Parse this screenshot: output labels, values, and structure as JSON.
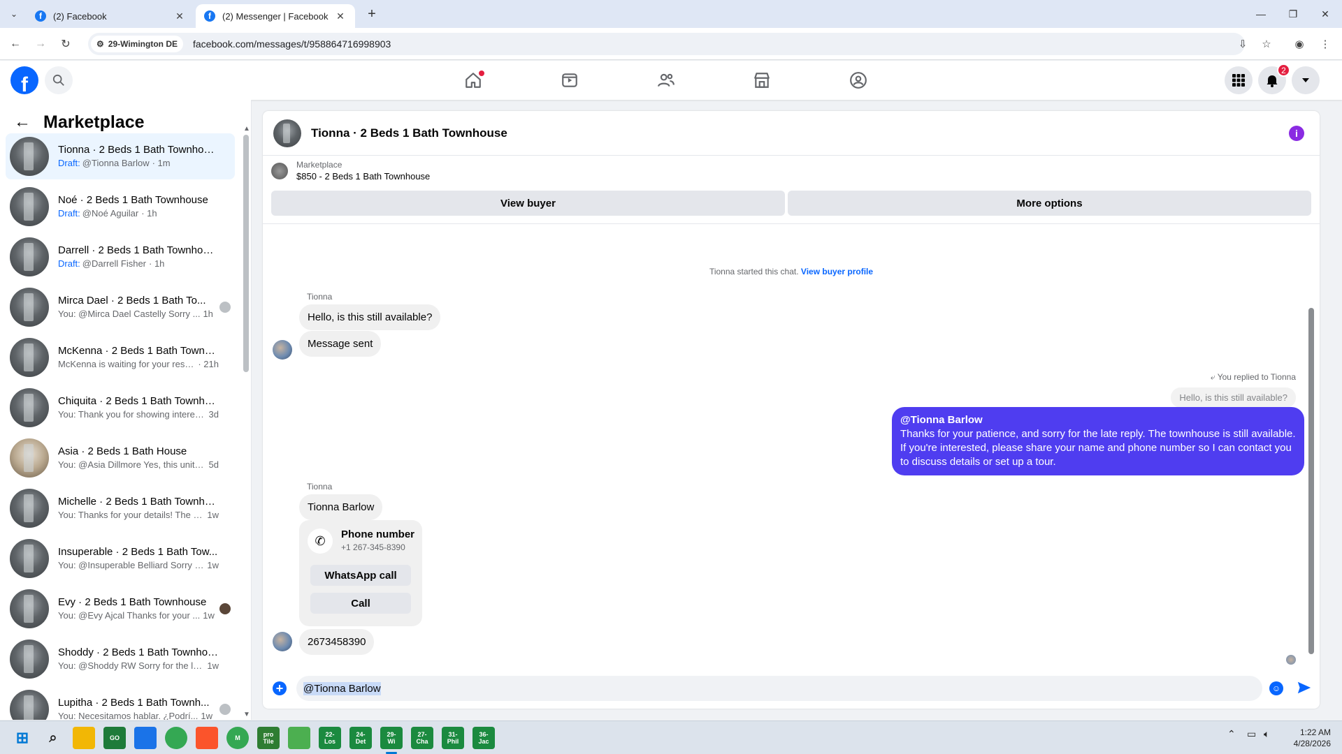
{
  "browser": {
    "tabs": [
      {
        "title": "(2) Facebook",
        "active": false
      },
      {
        "title": "(2) Messenger | Facebook",
        "active": true
      }
    ],
    "site_chip": "29-Wimington DE",
    "url": "facebook.com/messages/t/958864716998903"
  },
  "fb_header": {
    "logo": "f",
    "notification_count": "2",
    "nav_icons": [
      "home-icon",
      "video-icon",
      "friends-icon",
      "marketplace-icon",
      "groups-icon"
    ]
  },
  "sidebar": {
    "title": "Marketplace",
    "conversations": [
      {
        "name": "Tionna · 2 Beds 1 Bath Townhouse",
        "draft": "Draft:",
        "preview": "@Tionna Barlow",
        "time": "· 1m",
        "selected": true
      },
      {
        "name": "Noé · 2 Beds 1 Bath Townhouse",
        "draft": "Draft:",
        "preview": "@Noé Aguilar",
        "time": "· 1h"
      },
      {
        "name": "Darrell · 2 Beds 1 Bath Townhouse",
        "draft": "Draft:",
        "preview": "@Darrell Fisher",
        "time": "· 1h"
      },
      {
        "name": "Mirca Dael · 2 Beds 1 Bath To...",
        "draft": "",
        "preview": "You: @Mirca Dael Castelly Sorry ...",
        "time": "1h"
      },
      {
        "name": "McKenna · 2 Beds 1 Bath Townh...",
        "draft": "",
        "preview": "McKenna is waiting for your resp...",
        "time": "· 21h"
      },
      {
        "name": "Chiquita · 2 Beds 1 Bath Townho...",
        "draft": "",
        "preview": "You: Thank you for showing interes...",
        "time": "3d"
      },
      {
        "name": "Asia · 2 Beds 1 Bath House",
        "draft": "",
        "preview": "You: @Asia Dillmore Yes, this unit is...",
        "time": "5d"
      },
      {
        "name": "Michelle · 2 Beds 1 Bath Townho...",
        "draft": "",
        "preview": "You: Thanks for your details! The pr...",
        "time": "1w"
      },
      {
        "name": "Insuperable · 2 Beds 1 Bath Tow...",
        "draft": "",
        "preview": "You: @Insuperable Belliard Sorry fo...",
        "time": "1w"
      },
      {
        "name": "Evy · 2 Beds 1 Bath Townhouse",
        "draft": "",
        "preview": "You: @Evy Ajcal Thanks for your ...",
        "time": "1w"
      },
      {
        "name": "Shoddy · 2 Beds 1 Bath Townhou...",
        "draft": "",
        "preview": "You: @Shoddy RW Sorry for the lat...",
        "time": "1w"
      },
      {
        "name": "Lupitha · 2 Beds 1 Bath Townh...",
        "draft": "",
        "preview": "You: Necesitamos hablar. ¿Podrí...",
        "time": "1w"
      }
    ]
  },
  "chat": {
    "title": "Tionna · 2 Beds 1 Bath Townhouse",
    "listing_source": "Marketplace",
    "listing_title": "$850 - 2 Beds 1 Bath Townhouse",
    "view_buyer_label": "View buyer",
    "more_options_label": "More options",
    "system_text": "Tionna started this chat.",
    "system_link": "View buyer profile",
    "sender_name": "Tionna",
    "msg1": "Hello, is this still available?",
    "msg2": "Message sent",
    "reply_label": "You replied to Tionna",
    "reply_quote": "Hello, is this still available?",
    "my_mention": "@Tionna Barlow",
    "my_message": "Thanks for your patience, and sorry for the late reply. The townhouse is still available. If you're interested, please share your name and phone number so I can contact you to discuss details or set up a tour.",
    "sender_name_2": "Tionna",
    "msg3": "Tionna Barlow",
    "phone_card_title": "Phone number",
    "phone_card_number": "+1 267-345-8390",
    "whatsapp_label": "WhatsApp call",
    "call_label": "Call",
    "msg4": "2673458390",
    "composer_text": "@Tionna Barlow"
  },
  "taskbar": {
    "apps": [
      {
        "label": "",
        "icon": "windows-start-icon",
        "color": "#0078d4"
      },
      {
        "label": "",
        "icon": "search-icon",
        "color": "transparent"
      },
      {
        "label": "",
        "icon": "file-explorer-icon",
        "color": "#f2b705"
      },
      {
        "label": "GO",
        "icon": "go-app-icon",
        "color": "#1e7b3a"
      },
      {
        "label": "",
        "icon": "maps-icon",
        "color": "#1a73e8"
      },
      {
        "label": "",
        "icon": "chrome-icon",
        "color": "#34a853"
      },
      {
        "label": "",
        "icon": "brave-icon",
        "color": "#fb542b"
      },
      {
        "label": "M",
        "icon": "chrome-profile-icon",
        "color": "#34a853"
      },
      {
        "label": "pro\nTile",
        "icon": "protile-icon",
        "color": "#2e7d32"
      },
      {
        "label": "",
        "icon": "notepad-icon",
        "color": "#4caf50"
      },
      {
        "label": "22-\nLos",
        "icon": "sheet-icon",
        "color": "#1b8a3f"
      },
      {
        "label": "24-\nDet",
        "icon": "sheet-icon",
        "color": "#1b8a3f"
      },
      {
        "label": "29-\nWi",
        "icon": "sheet-icon",
        "color": "#1b8a3f"
      },
      {
        "label": "27-\nCha",
        "icon": "sheet-icon",
        "color": "#1b8a3f"
      },
      {
        "label": "31-\nPhil",
        "icon": "sheet-icon",
        "color": "#1b8a3f"
      },
      {
        "label": "36-\nJac",
        "icon": "sheet-icon",
        "color": "#1b8a3f"
      }
    ],
    "time": "1:22 AM",
    "date": "4/28/2026"
  }
}
